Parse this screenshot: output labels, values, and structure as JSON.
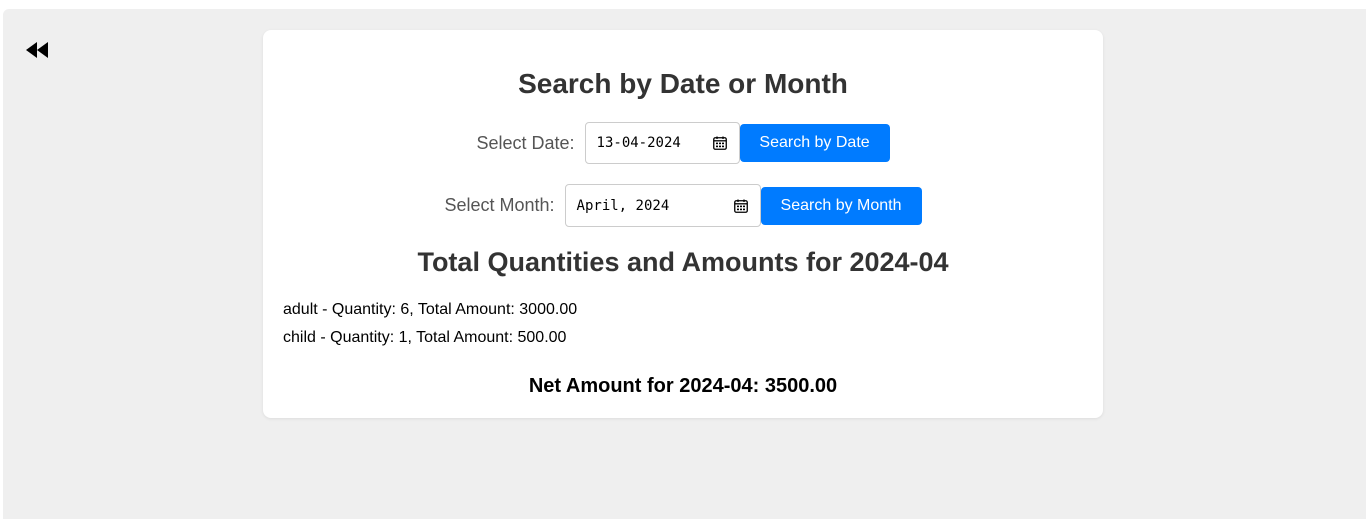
{
  "nav": {
    "back_icon": "rewind-icon"
  },
  "search": {
    "title": "Search by Date or Month",
    "date_label": "Select Date:",
    "date_value": "13-04-2024",
    "date_button": "Search by Date",
    "month_label": "Select Month:",
    "month_value": "April, 2024",
    "month_button": "Search by Month",
    "calendar_icon": "calendar-icon"
  },
  "results": {
    "title": "Total Quantities and Amounts for 2024-04",
    "items": [
      "adult - Quantity: 6, Total Amount: 3000.00",
      "child - Quantity: 1, Total Amount: 500.00"
    ],
    "net_amount": "Net Amount for 2024-04: 3500.00"
  },
  "colors": {
    "accent": "#007bff",
    "page_background": "#efefef",
    "card_background": "#ffffff",
    "heading": "#333333",
    "label": "#555555"
  }
}
